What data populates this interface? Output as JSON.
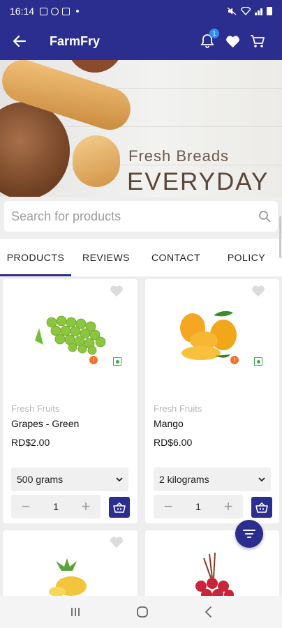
{
  "status_bar": {
    "time": "16:14"
  },
  "app_bar": {
    "title": "FarmFry",
    "notification_count": "1",
    "icons": [
      "back-arrow-icon",
      "bell-icon",
      "heart-icon",
      "cart-icon"
    ]
  },
  "hero": {
    "subtitle": "Fresh Breads",
    "headline": "EVERYDAY"
  },
  "search": {
    "placeholder": "Search for products"
  },
  "tabs": [
    {
      "label": "PRODUCTS",
      "active": true
    },
    {
      "label": "REVIEWS",
      "active": false
    },
    {
      "label": "CONTACT",
      "active": false
    },
    {
      "label": "POLICY",
      "active": false
    }
  ],
  "products": [
    {
      "category": "Fresh Fruits",
      "name": "Grapes - Green",
      "price": "RD$2.00",
      "variant": "500 grams",
      "quantity": "1"
    },
    {
      "category": "Fresh Fruits",
      "name": "Mango",
      "price": "RD$6.00",
      "variant": "2 kilograms",
      "quantity": "1"
    }
  ],
  "colors": {
    "primary": "#2b2e8e",
    "veg": "#3cae4a",
    "badge": "#2f8ef0"
  }
}
